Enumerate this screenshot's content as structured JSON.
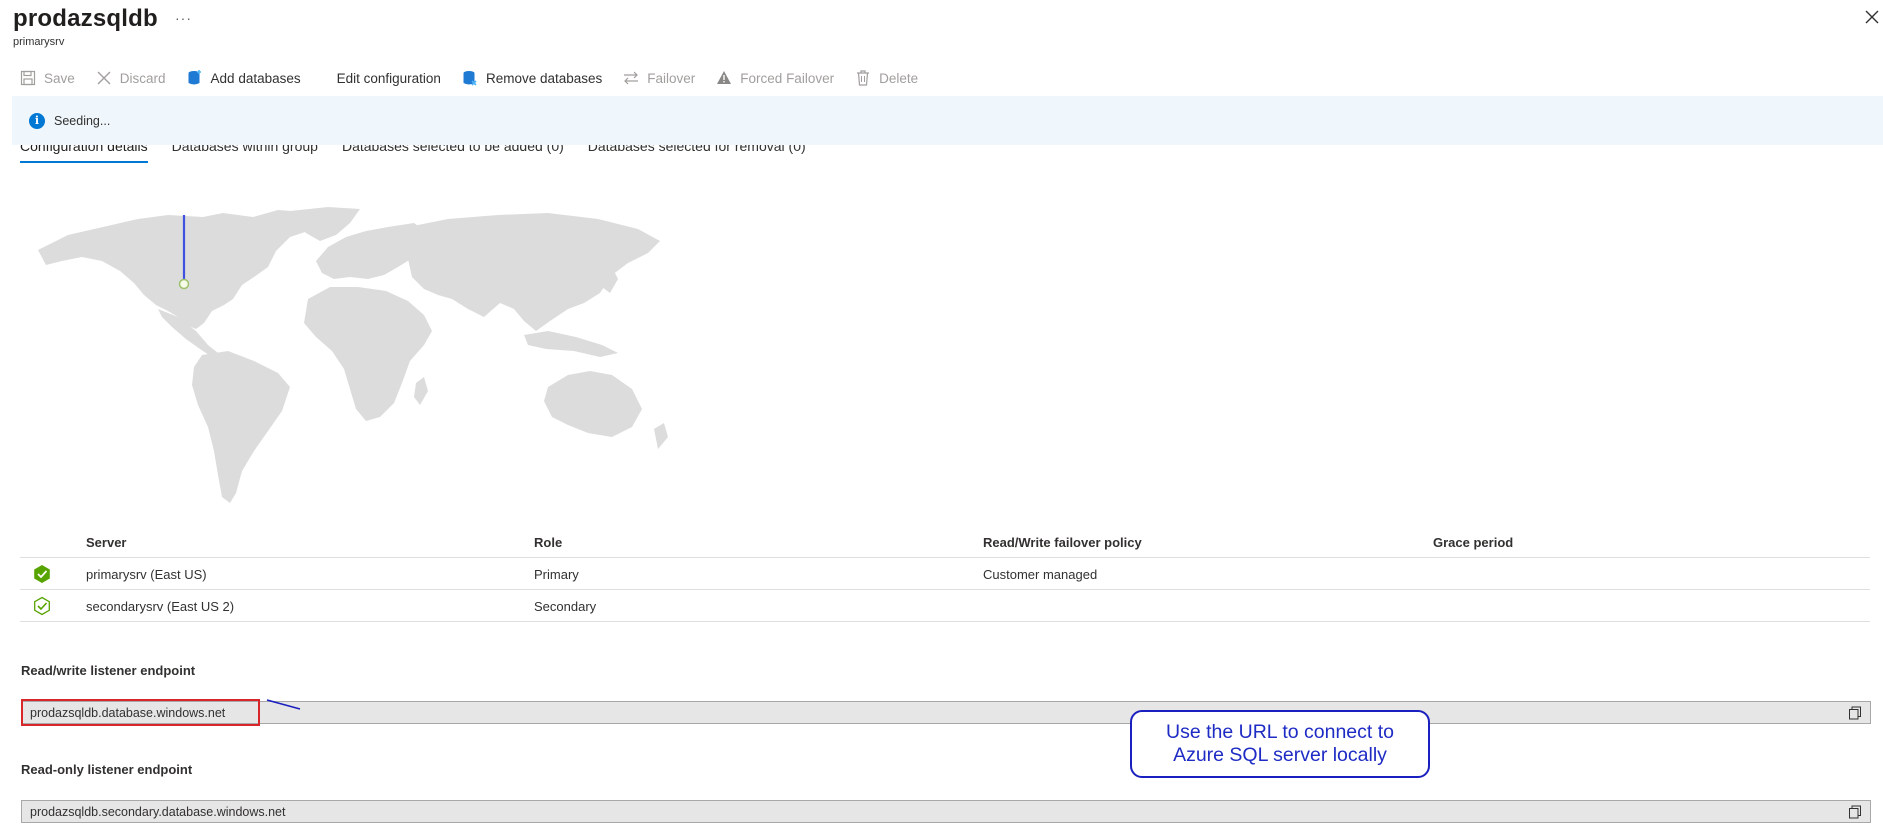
{
  "header": {
    "title": "prodazsqldb",
    "subtitle": "primarysrv",
    "more_label": "···"
  },
  "toolbar": {
    "save": "Save",
    "discard": "Discard",
    "add_databases": "Add databases",
    "edit_configuration": "Edit configuration",
    "remove_databases": "Remove databases",
    "failover": "Failover",
    "forced_failover": "Forced Failover",
    "delete": "Delete"
  },
  "banner": {
    "text": "Seeding..."
  },
  "tabs": [
    {
      "label": "Configuration details",
      "active": true
    },
    {
      "label": "Databases within group",
      "active": false
    },
    {
      "label": "Databases selected to be added (0)",
      "active": false
    },
    {
      "label": "Databases selected for removal (0)",
      "active": false
    }
  ],
  "table": {
    "headers": {
      "server": "Server",
      "role": "Role",
      "policy": "Read/Write failover policy",
      "grace": "Grace period"
    },
    "rows": [
      {
        "server": "primarysrv (East US)",
        "role": "Primary",
        "policy": "Customer managed",
        "grace": "",
        "status": "primary-check-icon"
      },
      {
        "server": "secondarysrv (East US 2)",
        "role": "Secondary",
        "policy": "",
        "grace": "",
        "status": "secondary-check-icon"
      }
    ]
  },
  "endpoints": {
    "rw_label": "Read/write listener endpoint",
    "rw_value": "prodazsqldb.database.windows.net",
    "ro_label": "Read-only listener endpoint",
    "ro_value": "prodazsqldb.secondary.database.windows.net"
  },
  "callout": {
    "line1": "Use the URL to connect to",
    "line2": "Azure SQL server locally"
  },
  "colors": {
    "accent": "#0078d4",
    "banner_bg": "#eff6fc",
    "success": "#57a300",
    "highlight_red": "#d9262b",
    "callout_blue": "#1e2bc4",
    "map_land": "#dcdcdc"
  }
}
